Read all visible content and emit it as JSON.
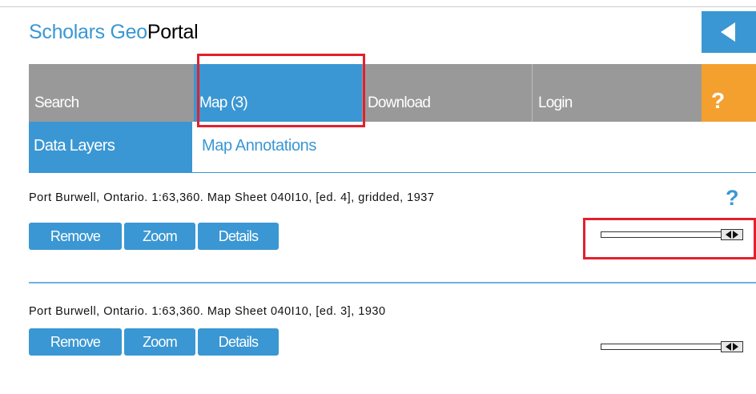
{
  "header": {
    "brand_prefix": "Scholars Geo",
    "brand_strong": "Portal",
    "collapse_icon": "chevron-left-icon"
  },
  "tabs": [
    {
      "label": "Search"
    },
    {
      "label": "Map (3)",
      "active": true
    },
    {
      "label": "Download"
    },
    {
      "label": "Login"
    },
    {
      "label": "?"
    }
  ],
  "subtabs": {
    "data_layers": "Data Layers",
    "map_annotations": "Map Annotations"
  },
  "help_label": "?",
  "layers": [
    {
      "title": "Port Burwell, Ontario. 1:63,360. Map Sheet 040I10, [ed. 4], gridded, 1937",
      "buttons": {
        "remove": "Remove",
        "zoom": "Zoom",
        "details": "Details"
      },
      "opacity": 1.0
    },
    {
      "title": "Port Burwell, Ontario. 1:63,360. Map Sheet 040I10, [ed. 3], 1930",
      "buttons": {
        "remove": "Remove",
        "zoom": "Zoom",
        "details": "Details"
      },
      "opacity": 1.0
    }
  ],
  "colors": {
    "accent": "#3a97d3",
    "tab_gray": "#999999",
    "help_orange": "#f4a02f",
    "highlight_red": "#e2202d"
  }
}
